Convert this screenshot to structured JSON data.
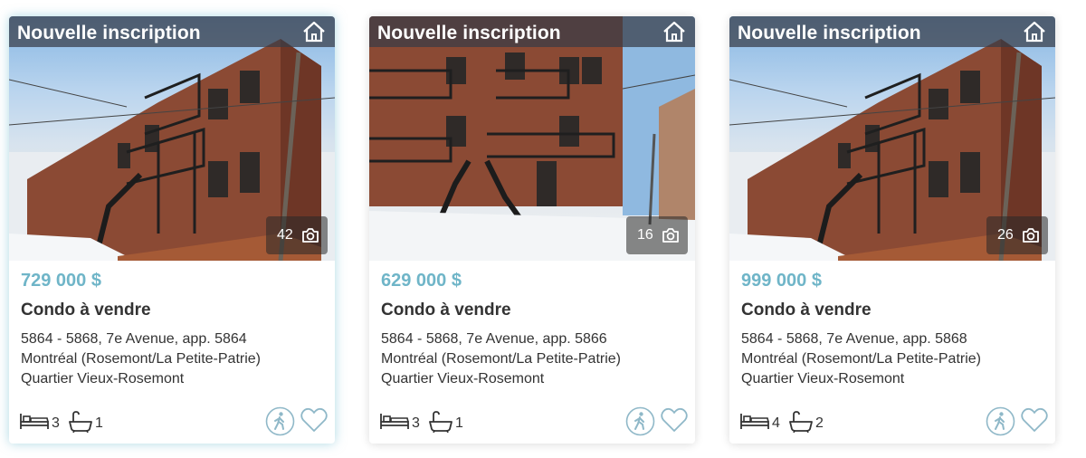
{
  "listings": [
    {
      "banner": "Nouvelle inscription",
      "photo_count": "42",
      "price": "729 000 $",
      "type": "Condo à vendre",
      "address_line1": "5864 - 5868, 7e Avenue, app. 5864",
      "address_line2": "Montréal (Rosemont/La Petite-Patrie)",
      "address_line3": "Quartier Vieux-Rosemont",
      "bedrooms": "3",
      "bathrooms": "1"
    },
    {
      "banner": "Nouvelle inscription",
      "photo_count": "16",
      "price": "629 000 $",
      "type": "Condo à vendre",
      "address_line1": "5864 - 5868, 7e Avenue, app. 5866",
      "address_line2": "Montréal (Rosemont/La Petite-Patrie)",
      "address_line3": "Quartier Vieux-Rosemont",
      "bedrooms": "3",
      "bathrooms": "1"
    },
    {
      "banner": "Nouvelle inscription",
      "photo_count": "26",
      "price": "999 000 $",
      "type": "Condo à vendre",
      "address_line1": "5864 - 5868, 7e Avenue, app. 5868",
      "address_line2": "Montréal (Rosemont/La Petite-Patrie)",
      "address_line3": "Quartier Vieux-Rosemont",
      "bedrooms": "4",
      "bathrooms": "2"
    }
  ],
  "icons": {
    "banner": "home-icon",
    "photos": "camera-icon",
    "bedrooms": "bed-icon",
    "bathrooms": "bathtub-icon",
    "walk": "walking-person-icon",
    "favorite": "heart-icon"
  },
  "colors": {
    "price": "#6fb5c8",
    "text": "#333333",
    "banner_bg": "#373c46",
    "icon_outline": "#8fb8c8",
    "brick": "#8b4a34"
  }
}
